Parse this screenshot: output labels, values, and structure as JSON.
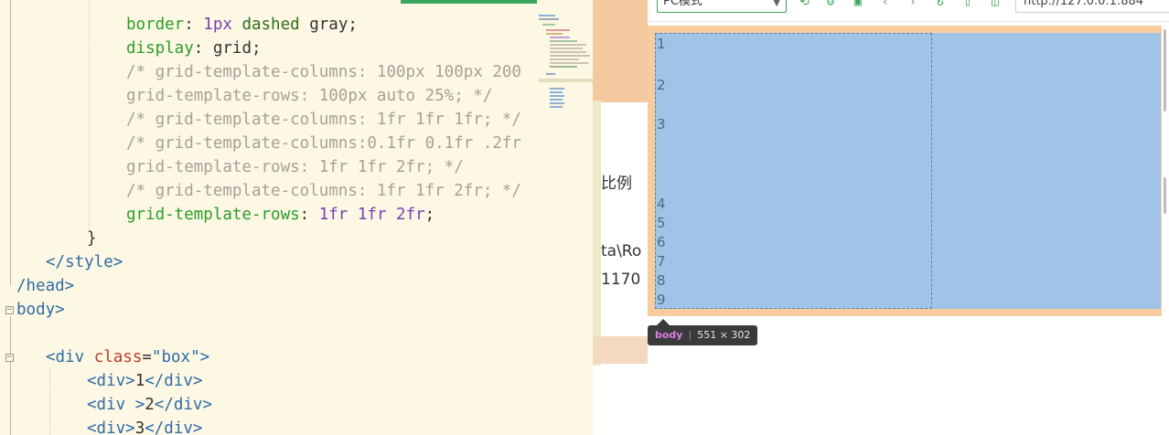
{
  "editor": {
    "lines": [
      [
        {
          "cls": "k",
          "text": "border"
        },
        {
          "cls": "",
          "text": ": "
        },
        {
          "cls": "v",
          "text": "1px"
        },
        {
          "cls": "",
          "text": " "
        },
        {
          "cls": "g",
          "text": "dashed"
        },
        {
          "cls": "",
          "text": " gray;"
        }
      ],
      [
        {
          "cls": "k",
          "text": "display"
        },
        {
          "cls": "",
          "text": ": grid;"
        }
      ],
      [
        {
          "cls": "c",
          "text": "/* grid-template-columns: 100px 100px 200"
        }
      ],
      [
        {
          "cls": "c",
          "text": "grid-template-rows: 100px auto 25%; */"
        }
      ],
      [
        {
          "cls": "c",
          "text": "/* grid-template-columns: 1fr 1fr 1fr; */"
        }
      ],
      [
        {
          "cls": "c",
          "text": "/* grid-template-columns:0.1fr 0.1fr .2fr"
        }
      ],
      [
        {
          "cls": "c",
          "text": "grid-template-rows: 1fr 1fr 2fr; */"
        }
      ],
      [
        {
          "cls": "c",
          "text": "/* grid-template-columns: 1fr 1fr 2fr; */"
        }
      ],
      [
        {
          "cls": "k",
          "text": "grid-template-rows"
        },
        {
          "cls": "",
          "text": ": "
        },
        {
          "cls": "v",
          "text": "1fr"
        },
        {
          "cls": "",
          "text": " "
        },
        {
          "cls": "v",
          "text": "1fr"
        },
        {
          "cls": "",
          "text": " "
        },
        {
          "cls": "v",
          "text": "2fr"
        },
        {
          "cls": "",
          "text": ";"
        }
      ],
      [
        {
          "cls": "",
          "text": "}"
        }
      ],
      [
        {
          "cls": "t",
          "text": "</style>"
        }
      ],
      [
        {
          "cls": "t",
          "text": "/head>"
        }
      ],
      [
        {
          "cls": "t",
          "text": "body>"
        }
      ],
      [
        {
          "cls": "",
          "text": ""
        }
      ],
      [
        {
          "cls": "t",
          "text": "<div "
        },
        {
          "cls": "a",
          "text": "class"
        },
        {
          "cls": "",
          "text": "="
        },
        {
          "cls": "s",
          "text": "\"box\""
        },
        {
          "cls": "t",
          "text": ">"
        }
      ],
      [
        {
          "cls": "t",
          "text": "<div>"
        },
        {
          "cls": "",
          "text": "1"
        },
        {
          "cls": "t",
          "text": "</div>"
        }
      ],
      [
        {
          "cls": "t",
          "text": "<div "
        },
        {
          "cls": "t",
          "text": ">"
        },
        {
          "cls": "",
          "text": "2"
        },
        {
          "cls": "t",
          "text": "</div>"
        }
      ],
      [
        {
          "cls": "t",
          "text": "<div>"
        },
        {
          "cls": "",
          "text": "3"
        },
        {
          "cls": "t",
          "text": "</div>"
        }
      ]
    ]
  },
  "middle_window": {
    "texts": [
      "比例",
      "ta\\Ro",
      "1170"
    ]
  },
  "browser": {
    "mode_select": "PC模式",
    "url": "http://127.0.0.1:884",
    "grid_cells": [
      "1",
      "2",
      "3",
      "4",
      "5",
      "6",
      "7",
      "8",
      "9"
    ],
    "tooltip": {
      "tag": "body",
      "size": "551 × 302"
    }
  },
  "colors": {
    "editor_bg": "#fdf8e3",
    "body_highlight": "#f8cc9f",
    "box_highlight": "#9fc4e8",
    "accent": "#3aa55c"
  },
  "icons": [
    "fold-collapse-icon",
    "back-icon",
    "forward-icon",
    "refresh-icon",
    "screenshot-icon",
    "devtools-icon",
    "chevron-down-icon"
  ]
}
